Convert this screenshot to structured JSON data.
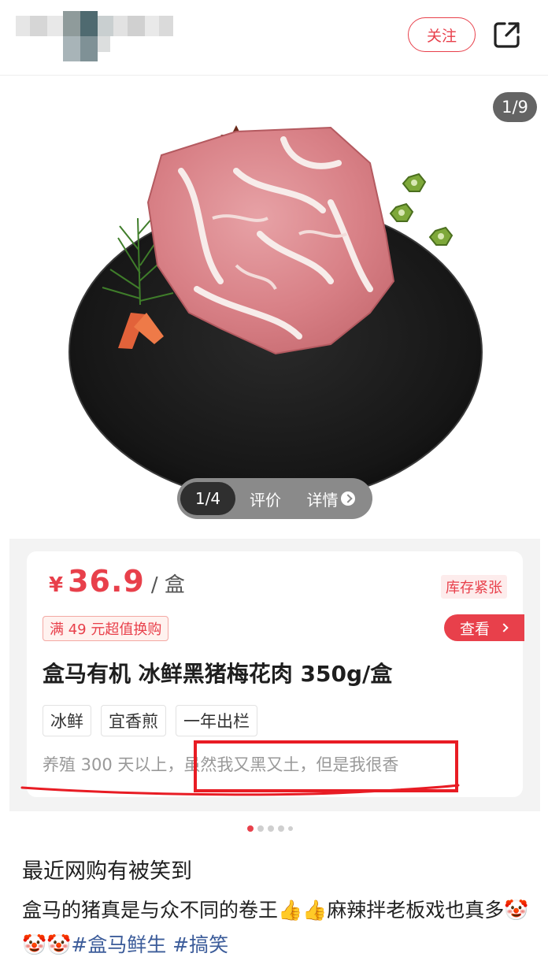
{
  "header": {
    "follow_label": "关注",
    "share_icon": "share-icon"
  },
  "gallery": {
    "counter": "1/9",
    "tabs": [
      {
        "label": "1/4",
        "active": true
      },
      {
        "label": "评价",
        "active": false
      },
      {
        "label": "详情",
        "active": false
      }
    ]
  },
  "product": {
    "currency": "¥",
    "price": "36.9",
    "unit": "/ 盒",
    "stock_badge": "库存紧张",
    "promo": "满 49 元超值换购",
    "view_button": "查看",
    "title": "盒马有机 冰鲜黑猪梅花肉 350g/盒",
    "tags": [
      "冰鲜",
      "宜香煎",
      "一年出栏"
    ],
    "desc_part1": "养殖 300 天以上，",
    "desc_part2": "虽然我又黑又土，但是我很香"
  },
  "post": {
    "title": "最近网购有被笑到",
    "body_text": "盒马的猪真是与众不同的卷王",
    "body_text2": "麻辣拌老板戏也真多",
    "hashtag1": "#盒马鲜生",
    "hashtag2": "#搞笑"
  },
  "colors": {
    "accent": "#e8404b",
    "highlight_box": "#e81c24",
    "hashtag": "#3c5c9a"
  }
}
